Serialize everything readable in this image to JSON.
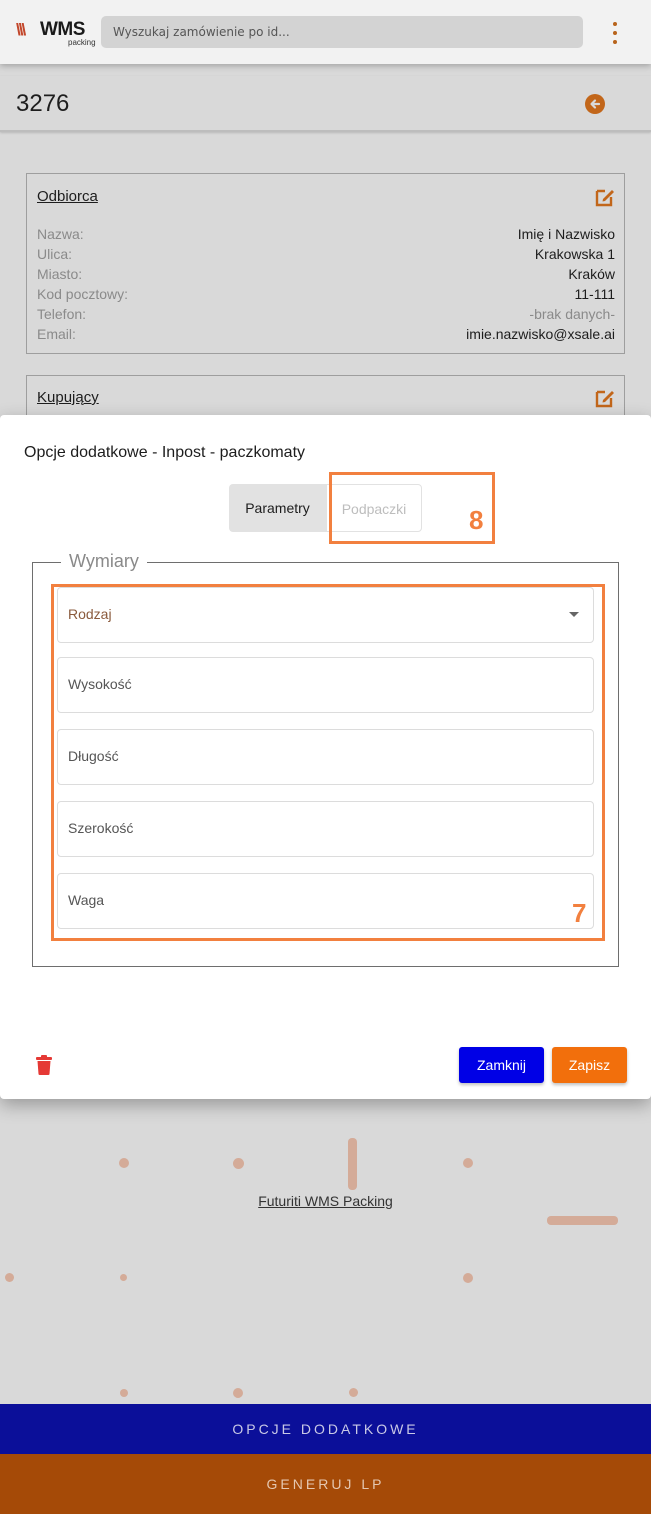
{
  "header": {
    "logo_mark": "\\\\\\",
    "logo_name": "WMS",
    "logo_sub": "packing",
    "search_placeholder": "Wyszukaj zamówienie po id...",
    "menu_icon": "kebab-menu-icon"
  },
  "order": {
    "id": "3276",
    "back_icon": "arrow-left-circle-icon"
  },
  "recipient": {
    "title": "Odbiorca",
    "rows": [
      {
        "key": "Nazwa:",
        "value": "Imię i Nazwisko"
      },
      {
        "key": "Ulica:",
        "value": "Krakowska 1"
      },
      {
        "key": "Miasto:",
        "value": "Kraków"
      },
      {
        "key": "Kod pocztowy:",
        "value": "11-111"
      },
      {
        "key": "Telefon:",
        "value": "-brak danych-"
      },
      {
        "key": "Email:",
        "value": "imie.nazwisko@xsale.ai"
      }
    ]
  },
  "buyer": {
    "title": "Kupujący"
  },
  "dialog": {
    "title": "Opcje dodatkowe - Inpost - paczkomaty",
    "tabs": [
      {
        "label": "Parametry",
        "active": true
      },
      {
        "label": "Podpaczki",
        "active": false
      }
    ],
    "fieldset_legend": "Wymiary",
    "fields": [
      {
        "label": "Rodzaj",
        "type": "select"
      },
      {
        "label": "Wysokość",
        "type": "text"
      },
      {
        "label": "Długość",
        "type": "text"
      },
      {
        "label": "Szerokość",
        "type": "text"
      },
      {
        "label": "Waga",
        "type": "text"
      }
    ],
    "annotations": {
      "fields": "7",
      "tab": "8"
    },
    "close_label": "Zamknij",
    "save_label": "Zapisz"
  },
  "footer": {
    "link": "Futuriti WMS Packing"
  },
  "actions": {
    "opcje": "OPCJE DODATKOWE",
    "generuj": "GENERUJ LP"
  },
  "colors": {
    "accent_orange": "#f26f0c",
    "primary_blue": "#0000e6",
    "annotation": "#f2803f",
    "delete_red": "#e53935"
  }
}
